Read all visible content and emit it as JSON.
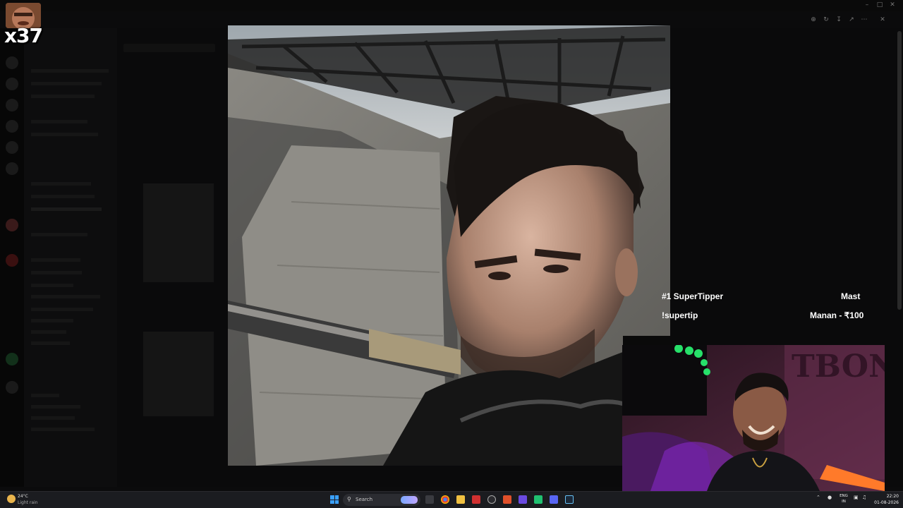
{
  "overlay": {
    "multiplier": "x37",
    "tipper_title": "#1 SuperTipper",
    "tipper_command": "!supertip",
    "tipper_name": "Mast",
    "tipper_amount": "Manan - ₹100"
  },
  "taskbar": {
    "weather_temp": "24°C",
    "weather_desc": "Light rain",
    "search_label": "Search",
    "lang_top": "ENG",
    "lang_bottom": "IN",
    "time": "22:20",
    "date": "01-08-2026"
  },
  "icons": {
    "window_controls": [
      "minimize-icon",
      "maximize-icon",
      "close-icon"
    ],
    "viewer_tools": [
      "zoom-icon",
      "rotate-icon",
      "download-icon",
      "open-external-icon",
      "more-icon",
      "close-viewer-icon"
    ],
    "taskbar_apps": [
      "windows-start-icon",
      "search-icon",
      "task-view-icon",
      "chrome-icon",
      "file-explorer-icon",
      "app-icon",
      "app-icon",
      "app-icon",
      "app-icon",
      "app-icon",
      "app-icon",
      "discord-icon",
      "steam-icon"
    ]
  },
  "colors": {
    "overlay_text": "#ffffff",
    "taskbar_bg": "#1b1c20",
    "accent": "#3aa0ff"
  }
}
